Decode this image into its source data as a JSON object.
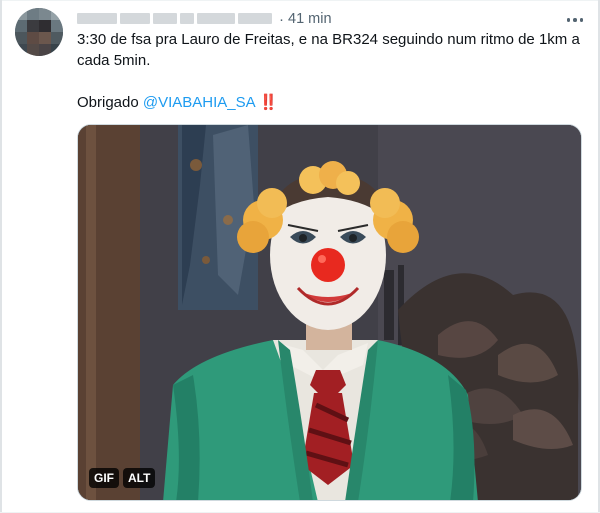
{
  "tweet": {
    "timestamp": "41 min",
    "separator": "·",
    "text_line1": "3:30 de fsa pra Lauro de Freitas, e na BR324 seguindo num ritmo de 1km a",
    "text_line2": "cada 5min.",
    "thanks_prefix": "Obrigado ",
    "mention": "@VIABAHIA_SA",
    "emoji": "‼️",
    "more_icon": "more-horizontal-icon"
  },
  "media": {
    "type": "gif",
    "gif_badge": "GIF",
    "alt_badge": "ALT"
  },
  "colors": {
    "link": "#1d9bf0",
    "secondary_text": "#536471",
    "text": "#0f1419",
    "cardigan": "#2f9a7a",
    "clown_nose": "#e8291f"
  }
}
